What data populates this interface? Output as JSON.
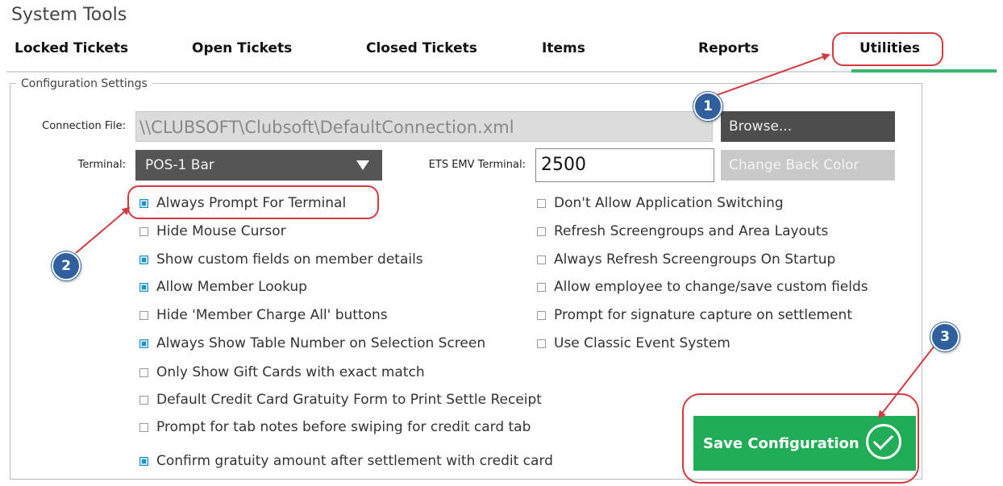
{
  "window": {
    "title": "System Tools"
  },
  "tabs": [
    {
      "label": "Locked Tickets"
    },
    {
      "label": "Open Tickets"
    },
    {
      "label": "Closed Tickets"
    },
    {
      "label": "Items"
    },
    {
      "label": "Reports"
    },
    {
      "label": "Utilities",
      "active": true
    }
  ],
  "config": {
    "legend": "Configuration Settings",
    "connection_label": "Connection File:",
    "connection_value": "\\\\CLUBSOFT\\Clubsoft\\DefaultConnection.xml",
    "browse_label": "Browse...",
    "terminal_label": "Terminal:",
    "terminal_value": "POS-1 Bar",
    "ets_label": "ETS EMV Terminal:",
    "ets_value": "2500",
    "change_color_label": "Change Back Color"
  },
  "left_options": [
    {
      "label": "Always Prompt For Terminal",
      "checked": true
    },
    {
      "label": "Hide Mouse Cursor",
      "checked": false
    },
    {
      "label": "Show custom fields on member details",
      "checked": true
    },
    {
      "label": "Allow Member Lookup",
      "checked": true
    },
    {
      "label": "Hide 'Member Charge All' buttons",
      "checked": false
    },
    {
      "label": "Always Show Table Number on Selection Screen",
      "checked": true
    },
    {
      "label": "Only Show Gift Cards with exact match",
      "checked": false
    },
    {
      "label": "Default Credit Card Gratuity Form to Print Settle Receipt",
      "checked": false
    },
    {
      "label": "Prompt for tab notes before swiping for credit card tab",
      "checked": false
    },
    {
      "label": "Confirm gratuity amount after settlement with credit card",
      "checked": true
    }
  ],
  "right_options": [
    {
      "label": "Don't Allow Application Switching",
      "checked": false
    },
    {
      "label": "Refresh Screengroups and Area Layouts",
      "checked": false
    },
    {
      "label": "Always Refresh Screengroups On Startup",
      "checked": false
    },
    {
      "label": "Allow employee to change/save custom fields",
      "checked": false
    },
    {
      "label": "Prompt for signature capture on settlement",
      "checked": false
    },
    {
      "label": "Use Classic Event System",
      "checked": false
    }
  ],
  "save_label": "Save Configuration",
  "callouts": [
    "1",
    "2",
    "3"
  ],
  "colors": {
    "accent_green": "#21ad57",
    "callout_red": "#d33a40",
    "badge_blue": "#2f5f9e",
    "checkbox_blue": "#1e90c8"
  }
}
